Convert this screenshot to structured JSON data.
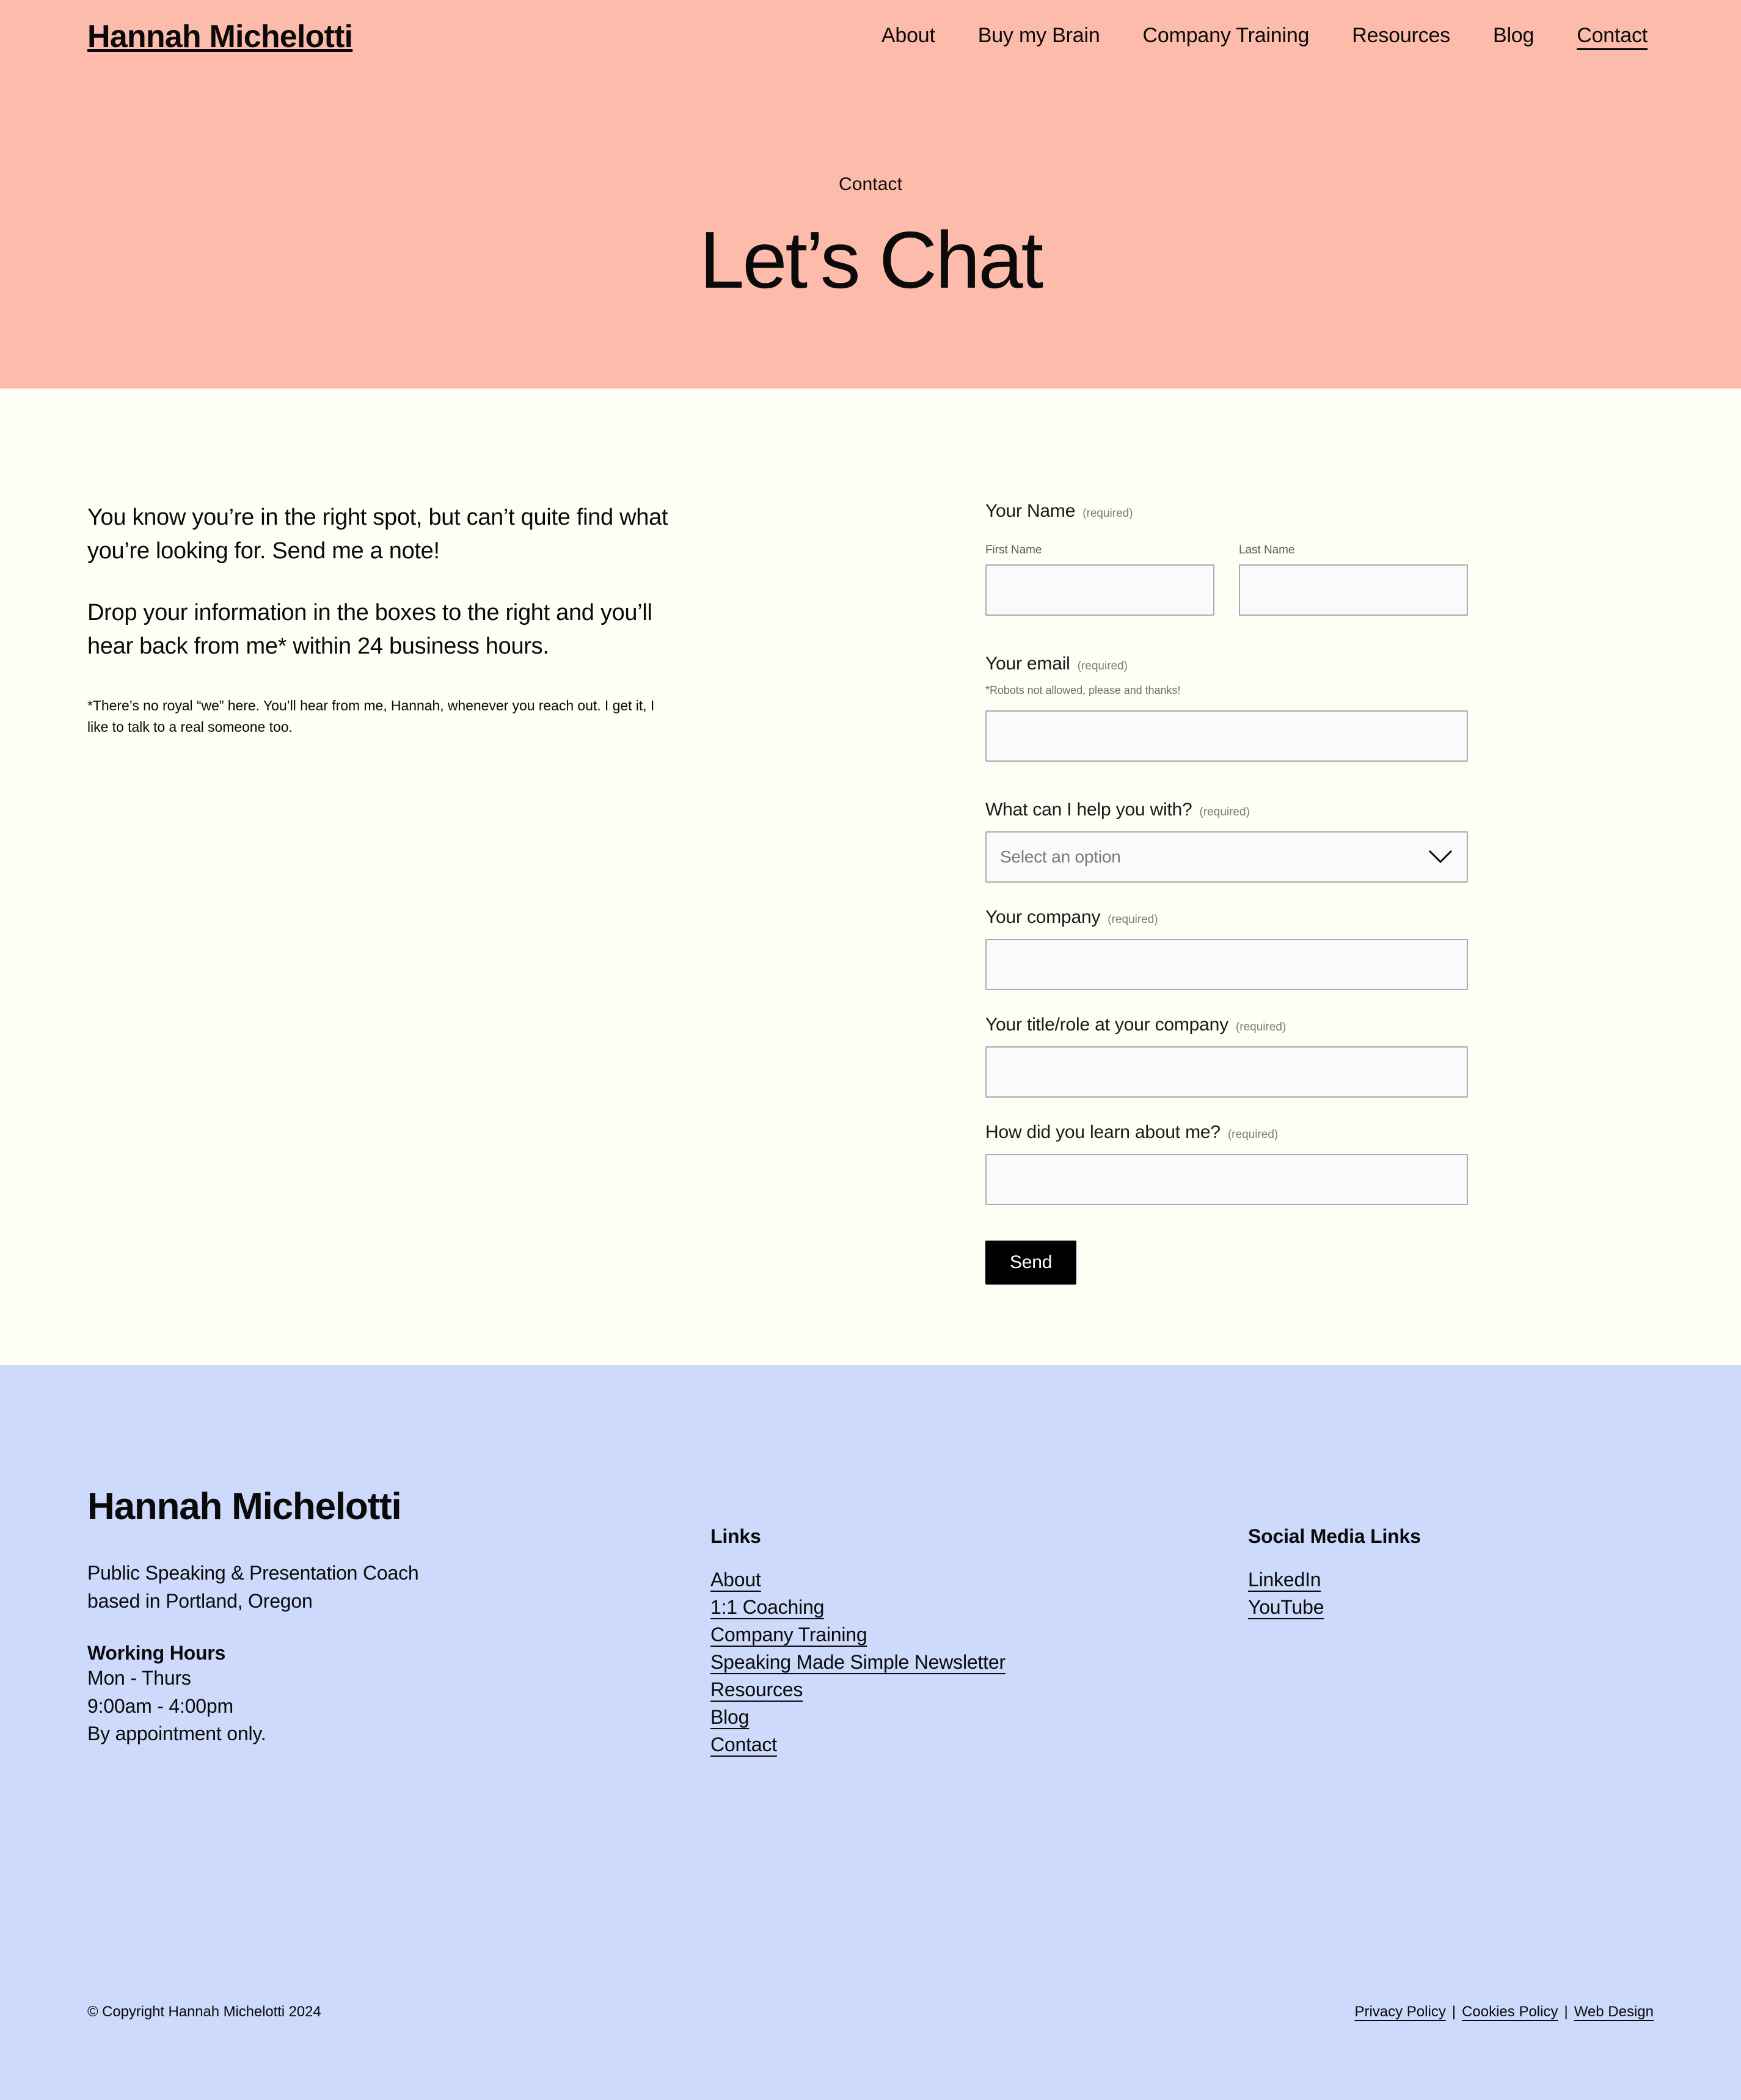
{
  "header": {
    "brand": "Hannah Michelotti",
    "nav": [
      {
        "label": "About",
        "active": false
      },
      {
        "label": "Buy my Brain",
        "active": false
      },
      {
        "label": "Company Training",
        "active": false
      },
      {
        "label": "Resources",
        "active": false
      },
      {
        "label": "Blog",
        "active": false
      },
      {
        "label": "Contact",
        "active": true
      }
    ]
  },
  "hero": {
    "eyebrow": "Contact",
    "title": "Let’s Chat",
    "background_color": "#FDBCAB"
  },
  "main": {
    "background_color": "#FFFEF4",
    "intro_paragraph_1": "You know you’re in the right spot, but can’t quite find what you’re looking for. Send me a note!",
    "intro_paragraph_2": "Drop your information in the boxes to the right and you’ll hear back from me* within 24 business hours.",
    "footnote": "*There’s no royal “we” here. You’ll hear from me, Hannah, whenever you reach out. I get it, I like to talk to a real someone too."
  },
  "form": {
    "required_tag": "(required)",
    "name": {
      "label": "Your Name",
      "first_sublabel": "First Name",
      "last_sublabel": "Last Name",
      "first_value": "",
      "last_value": ""
    },
    "email": {
      "label": "Your email",
      "hint": "*Robots not allowed, please and thanks!",
      "value": ""
    },
    "help": {
      "label": "What can I help you with?",
      "placeholder": "Select an option",
      "selected": "",
      "chevron_icon": "chevron-down-icon"
    },
    "company": {
      "label": "Your company",
      "value": ""
    },
    "title_role": {
      "label": "Your title/role at your company",
      "value": ""
    },
    "learn_about": {
      "label": "How did you learn about me?",
      "value": ""
    },
    "submit_label": "Send",
    "submit_bg": "#000000"
  },
  "footer": {
    "background_color": "#CDDAFB",
    "brand": "Hannah Michelotti",
    "tagline_line1": "Public Speaking & Presentation Coach",
    "tagline_line2": "based in Portland, Oregon",
    "working_hours_title": "Working Hours",
    "working_hours_lines": [
      "Mon - Thurs",
      "9:00am - 4:00pm",
      "By appointment only."
    ],
    "links_heading": "Links",
    "links": [
      "About",
      "1:1 Coaching",
      "Company Training",
      "Speaking Made Simple Newsletter",
      "Resources",
      "Blog",
      "Contact"
    ],
    "social_heading": "Social Media Links",
    "social_links": [
      "LinkedIn",
      "YouTube"
    ],
    "copyright": "© Copyright Hannah Michelotti 2024",
    "legal": {
      "privacy": "Privacy Policy",
      "cookies": "Cookies Policy",
      "web_design": "Web Design",
      "separator": "|"
    }
  }
}
